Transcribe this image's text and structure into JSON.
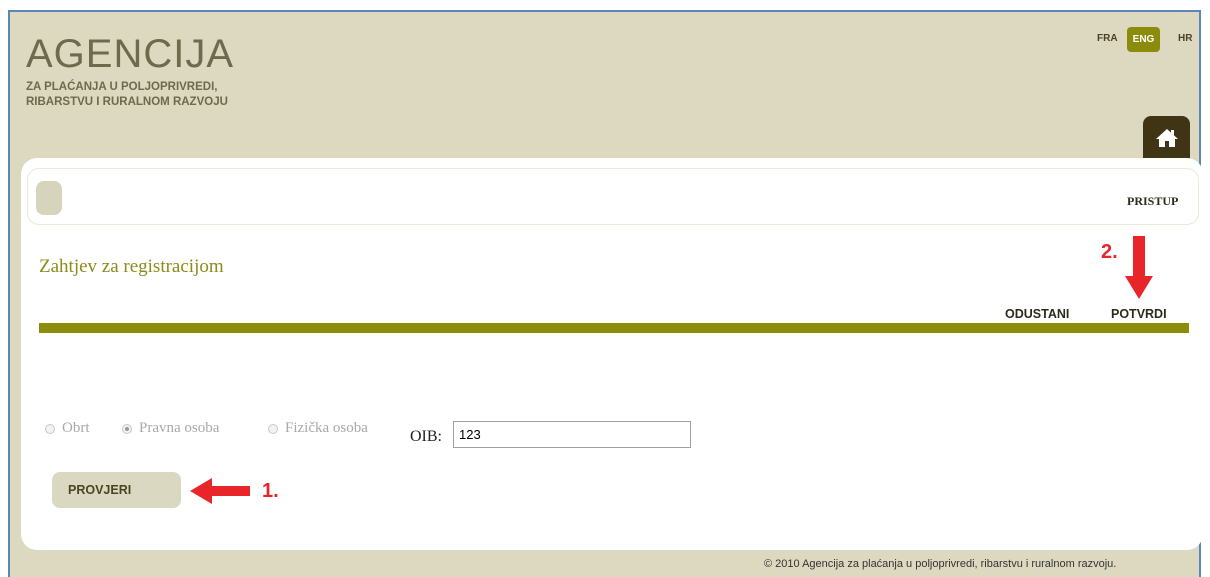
{
  "header": {
    "logo_title": "AGENCIJA",
    "logo_subtitle": "ZA PLAĆANJA U POLJOPRIVREDI, RIBARSTVU I RURALNOM RAZVOJU",
    "languages": [
      "FRA",
      "ENG",
      "HR"
    ],
    "active_language": "ENG",
    "home_icon": "home-icon"
  },
  "nav": {
    "pristup": "PRISTUP"
  },
  "form": {
    "title": "Zahtjev za registracijom",
    "cancel_label": "ODUSTANI",
    "confirm_label": "POTVRDI",
    "options": [
      "Obrt",
      "Pravna osoba",
      "Fizička osoba"
    ],
    "selected_option": "Pravna osoba",
    "oib_label": "OIB:",
    "oib_value": "123",
    "check_button": "PROVJERI"
  },
  "annotations": {
    "step1": "1.",
    "step2": "2.",
    "color": "#e8262a"
  },
  "footer": {
    "copyright": "© 2010 Agencija za plaćanja u poljoprivredi, ribarstvu i ruralnom razvoju."
  },
  "colors": {
    "accent": "#8d8d0c",
    "background": "#dcd9c0",
    "home_tab": "#3f3414"
  }
}
